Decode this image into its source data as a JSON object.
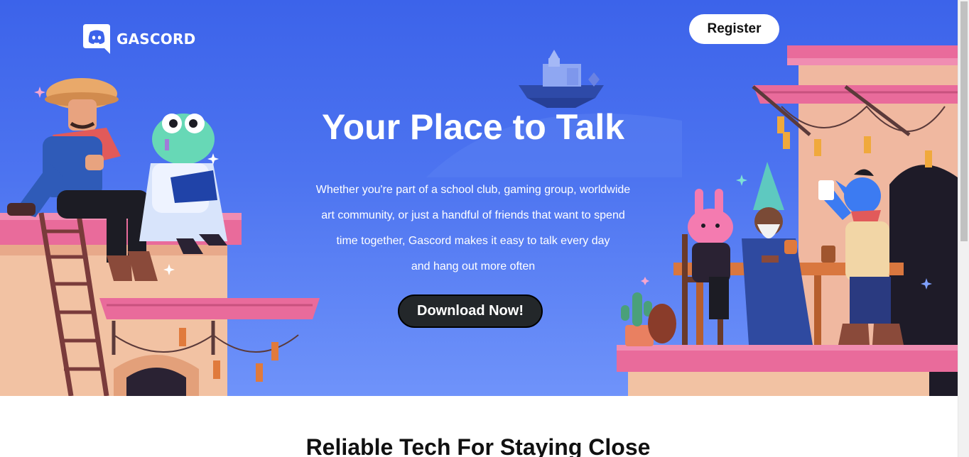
{
  "brand": {
    "name": "GASCORD",
    "logo_icon": "discord-logo-icon"
  },
  "nav": {
    "register_label": "Register"
  },
  "hero": {
    "title": "Your Place to Talk",
    "lines": [
      "Whether you're part of a school club, gaming group, worldwide",
      "art community, or just a handful of friends that want to spend",
      "time together, Gascord makes it easy to talk every day",
      "and hang out more often"
    ],
    "download_label": "Download Now!"
  },
  "features": {
    "title": "Reliable Tech For Staying Close"
  },
  "colors": {
    "hero_top": "#3c63ea",
    "hero_bottom": "#6f93fa",
    "button_dark": "#23272a",
    "accent_pink": "#e96b9b"
  }
}
